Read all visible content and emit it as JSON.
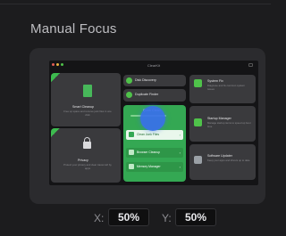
{
  "section": {
    "title": "Manual Focus"
  },
  "preview": {
    "app_title": "ClearKit",
    "window_dot_colors": [
      "#e35d54",
      "#e8b23f",
      "#4fc24a"
    ],
    "cards": {
      "smart_cleanup": {
        "title": "Smart Cleanup",
        "subtitle": "Free up space and remove junk files in one click"
      },
      "privacy": {
        "title": "Privacy",
        "subtitle": "Protect your privacy and clear traces left by apps"
      },
      "disk_discovery": {
        "title": "Disk Discovery"
      },
      "duplicate_finder": {
        "title": "Duplicate Finder"
      },
      "system_fix": {
        "title": "System Fix",
        "subtitle": "Diagnose and fix common system issues"
      },
      "startup": {
        "title": "Startup Manager",
        "subtitle": "Manage startup items to speed up boot time"
      },
      "software": {
        "title": "Software Updater",
        "subtitle": "Keep your apps and drivers up to date"
      }
    },
    "green_panel": {
      "title": "Quick Clean",
      "rows": [
        {
          "label": "Clean Junk Files"
        },
        {
          "label": "Browser Cleanup"
        },
        {
          "label": "Memory Manager"
        }
      ]
    }
  },
  "focus": {
    "x_label": "X:",
    "x_value": "50%",
    "y_label": "Y:",
    "y_value": "50%"
  },
  "colors": {
    "accent_green": "#34a853",
    "focus_blue": "#3870ec"
  }
}
